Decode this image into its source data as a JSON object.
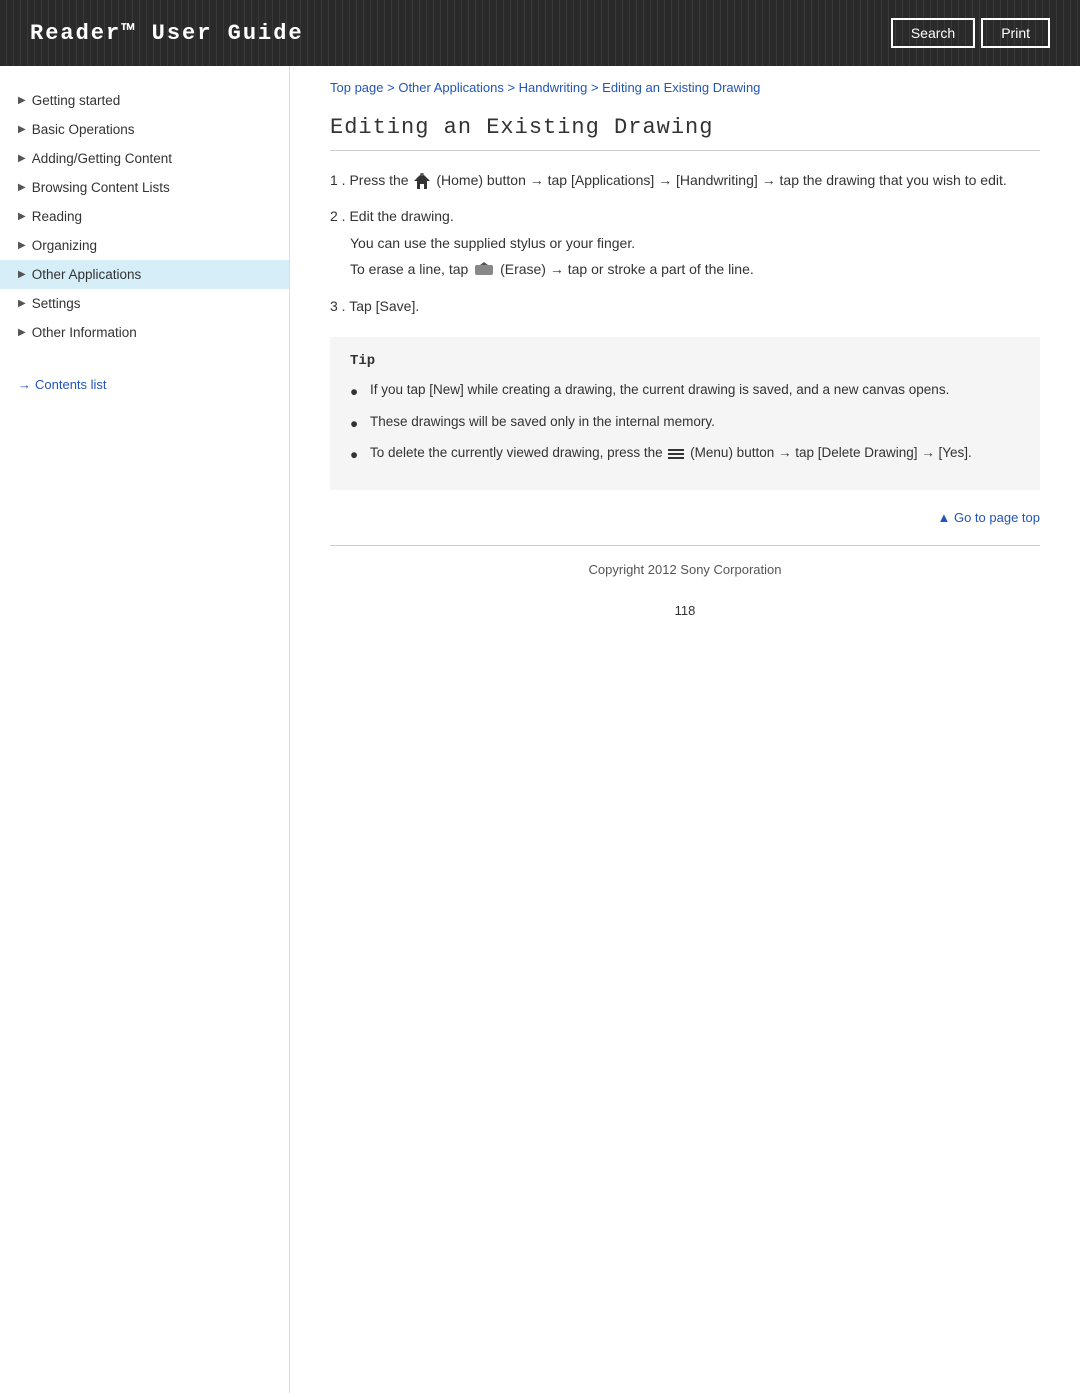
{
  "header": {
    "title": "Reader™ User Guide",
    "search_label": "Search",
    "print_label": "Print"
  },
  "sidebar": {
    "items": [
      {
        "id": "getting-started",
        "label": "Getting started",
        "active": false
      },
      {
        "id": "basic-operations",
        "label": "Basic Operations",
        "active": false
      },
      {
        "id": "adding-content",
        "label": "Adding/Getting Content",
        "active": false
      },
      {
        "id": "browsing",
        "label": "Browsing Content Lists",
        "active": false
      },
      {
        "id": "reading",
        "label": "Reading",
        "active": false
      },
      {
        "id": "organizing",
        "label": "Organizing",
        "active": false
      },
      {
        "id": "other-applications",
        "label": "Other Applications",
        "active": true
      },
      {
        "id": "settings",
        "label": "Settings",
        "active": false
      },
      {
        "id": "other-information",
        "label": "Other Information",
        "active": false
      }
    ],
    "contents_list_label": "Contents list",
    "contents_list_arrow": "→"
  },
  "breadcrumb": {
    "top_page": "Top page",
    "sep1": " > ",
    "other_apps": "Other Applications",
    "sep2": " > ",
    "handwriting": "Handwriting",
    "sep3": " > ",
    "current": "Editing an Existing Drawing"
  },
  "page": {
    "title": "Editing an Existing Drawing",
    "steps": [
      {
        "num": "1",
        "text_before": ". Press the",
        "home_icon": "🏠",
        "text_after": "(Home) button → tap [Applications] → [Handwriting] → tap the drawing that you wish to edit."
      },
      {
        "num": "2",
        "text": ". Edit the drawing.",
        "sub1": "You can use the supplied stylus or your finger.",
        "sub2_before": "To erase a line, tap",
        "erase_icon": "⊕",
        "sub2_after": "(Erase) → tap or stroke a part of the line."
      },
      {
        "num": "3",
        "text": ". Tap [Save]."
      }
    ],
    "tip": {
      "label": "Tip",
      "items": [
        "If you tap [New] while creating a drawing, the current drawing is saved, and a new canvas opens.",
        "These drawings will be saved only in the internal memory.",
        "To delete the currently viewed drawing, press the  (Menu) button → tap [Delete Drawing] → [Yes]."
      ]
    },
    "go_to_top": "▲ Go to page top",
    "footer": "Copyright 2012 Sony Corporation",
    "page_num": "118"
  }
}
